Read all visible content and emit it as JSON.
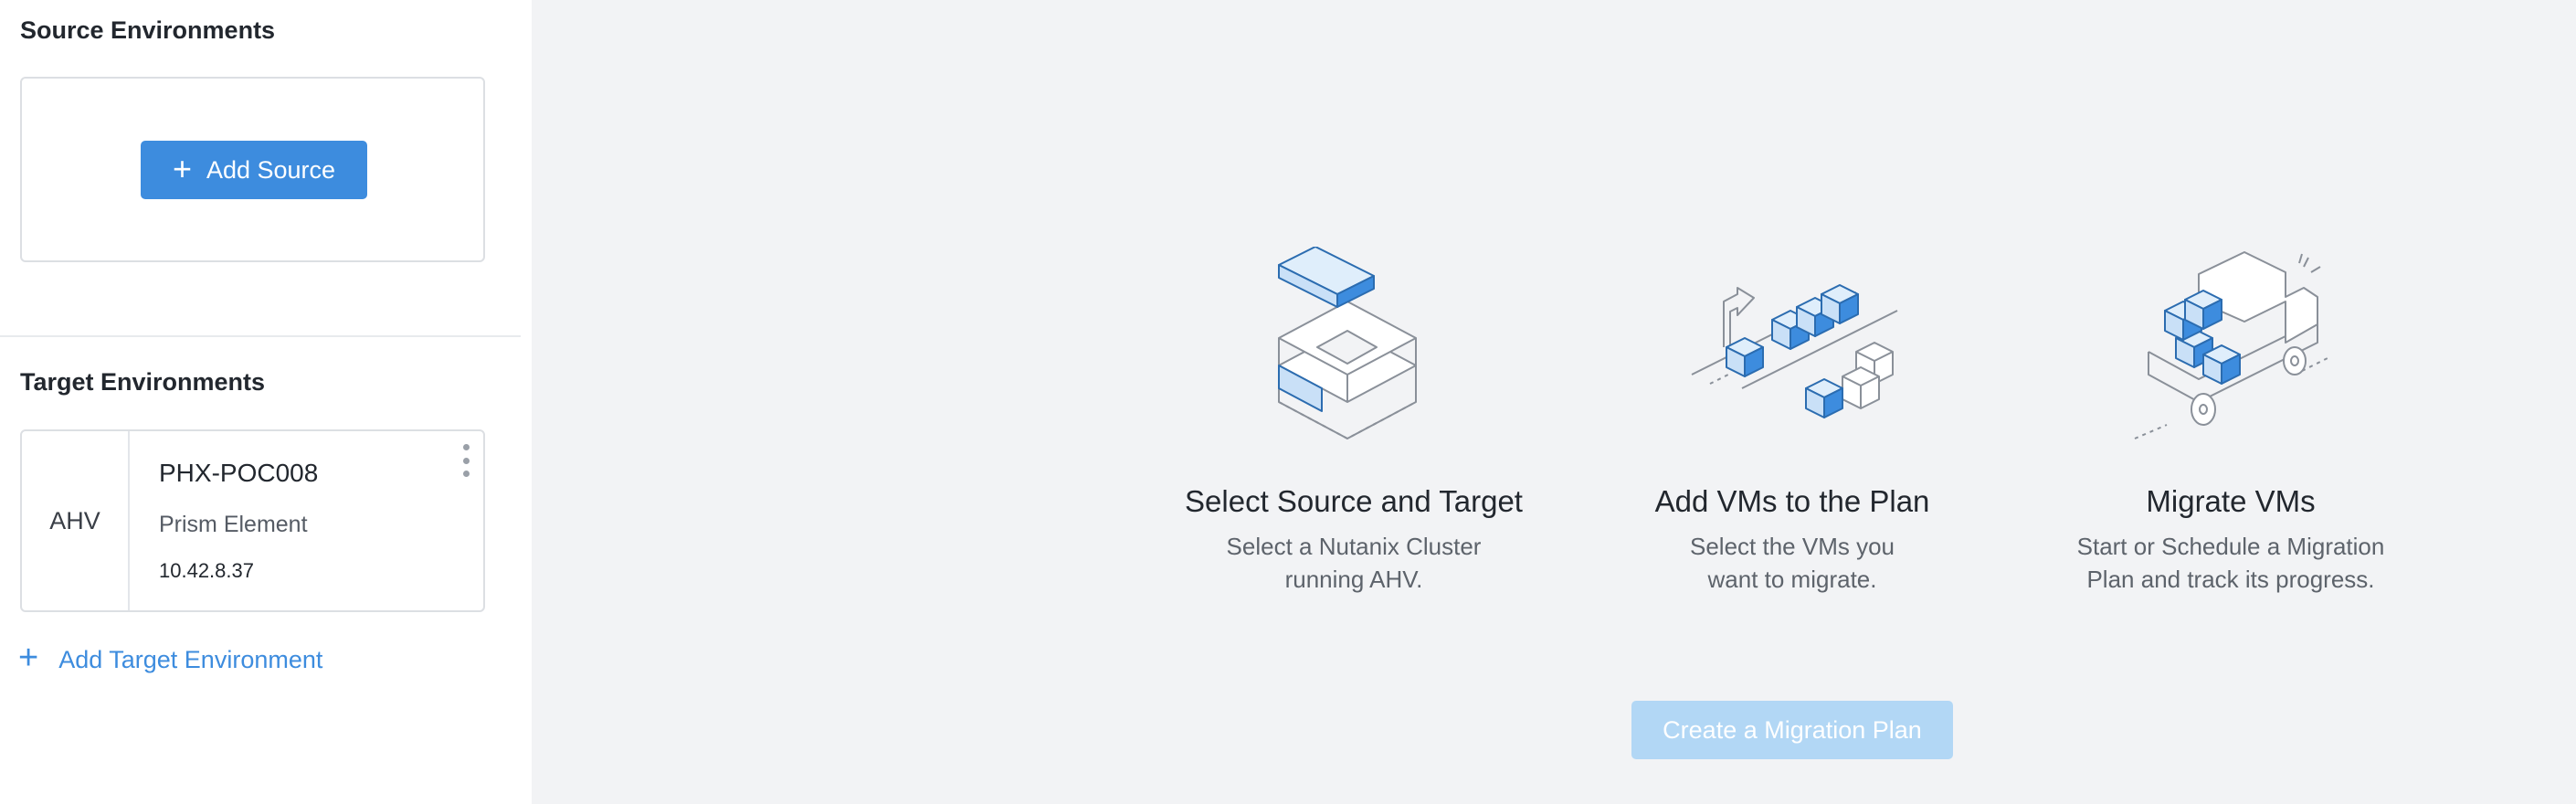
{
  "sidebar": {
    "source_title": "Source Environments",
    "add_source_label": "Add Source",
    "target_title": "Target Environments",
    "target": {
      "type": "AHV",
      "name": "PHX-POC008",
      "kind": "Prism Element",
      "ip": "10.42.8.37"
    },
    "add_target_label": "Add Target Environment"
  },
  "steps": [
    {
      "title": "Select Source and Target",
      "desc_line1": "Select a Nutanix Cluster",
      "desc_line2": "running AHV."
    },
    {
      "title": "Add VMs to the Plan",
      "desc_line1": "Select the VMs you",
      "desc_line2": "want to migrate."
    },
    {
      "title": "Migrate VMs",
      "desc_line1": "Start or Schedule a Migration",
      "desc_line2": "Plan and track its progress."
    }
  ],
  "create_plan_label": "Create a Migration Plan",
  "colors": {
    "accent": "#3d8cde",
    "disabled_button": "#b2d7f5",
    "illustration_blue": "#3d8cde",
    "illustration_gray": "#8a9099"
  }
}
